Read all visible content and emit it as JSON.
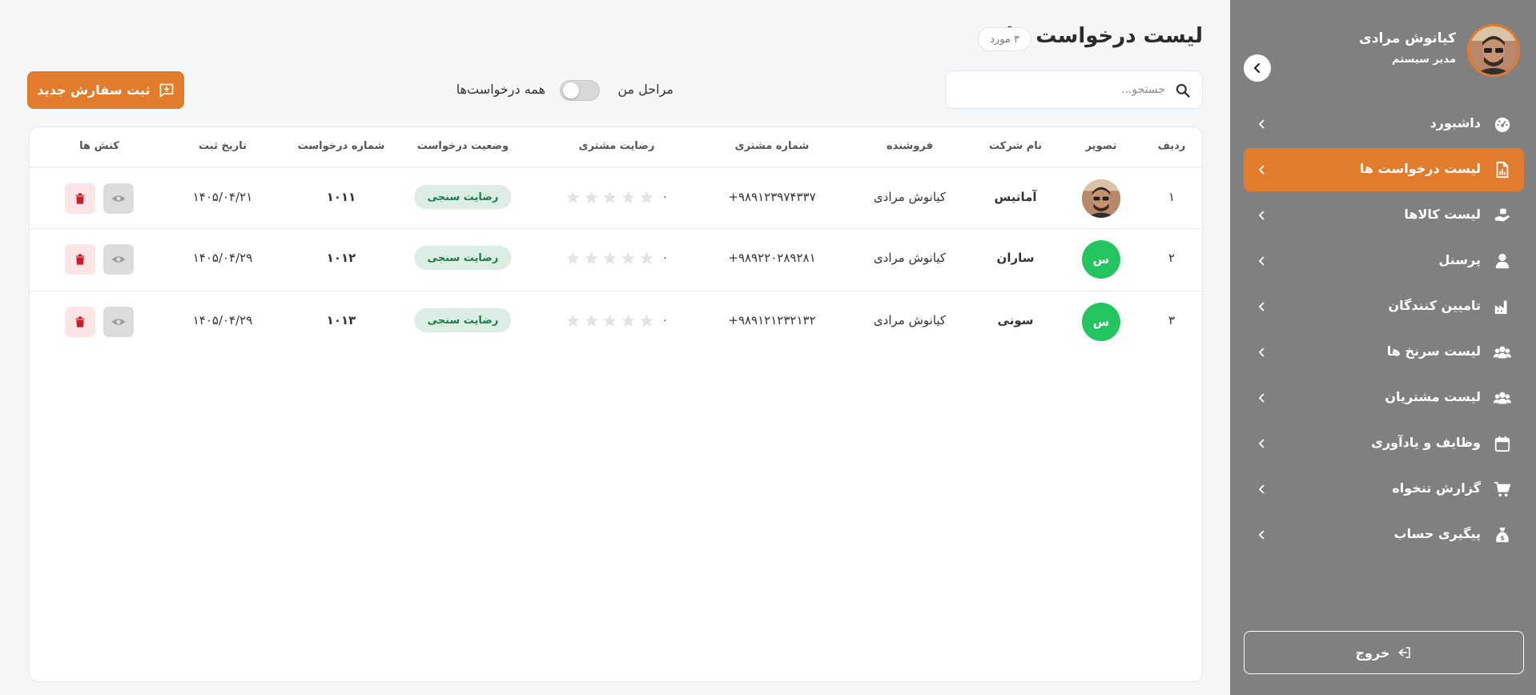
{
  "sidebar": {
    "profile_name": "کیانوش مرادی",
    "profile_role": "مدیر سیستم",
    "items": [
      {
        "label": "داشبورد",
        "icon": "gauge-icon",
        "active": false
      },
      {
        "label": "لیست درخواست ها",
        "icon": "document-chart-icon",
        "active": true
      },
      {
        "label": "لیست کالاها",
        "icon": "hand-box-icon",
        "active": false
      },
      {
        "label": "پرسنل",
        "icon": "user-icon",
        "active": false
      },
      {
        "label": "تامیین کنندگان",
        "icon": "factory-icon",
        "active": false
      },
      {
        "label": "لیست سرنخ ها",
        "icon": "users-icon",
        "active": false
      },
      {
        "label": "لیست مشتریان",
        "icon": "users-icon",
        "active": false
      },
      {
        "label": "وظایف و یادآوری",
        "icon": "calendar-icon",
        "active": false
      },
      {
        "label": "گزارش تنخواه",
        "icon": "cart-icon",
        "active": false
      },
      {
        "label": "پیگیری حساب",
        "icon": "money-bag-icon",
        "active": false
      }
    ],
    "logout_label": "خروج"
  },
  "header": {
    "title": "لیست درخواست ها",
    "count_badge": "۳ مورد"
  },
  "toolbar": {
    "search_placeholder": "جستجو...",
    "search_value": "",
    "my_steps_label": "مراحل من",
    "all_requests_label": "همه درخواست‌ها",
    "toggle_on": false,
    "new_order_label": "ثبت سفارش جدید"
  },
  "table": {
    "headers": {
      "row": "ردیف",
      "image": "تصویر",
      "company": "نام شرکت",
      "seller": "فروشنده",
      "phone": "شماره مشتری",
      "satisfaction": "رضایت مشتری",
      "status": "وضعیت درخواست",
      "request_no": "شماره درخواست",
      "date": "تاریخ ثبت",
      "actions": "کنش ها"
    },
    "rows": [
      {
        "row": "۱",
        "avatar": "photo",
        "company": "آماتیس",
        "seller": "کیانوش مرادی",
        "phone": "+۹۸۹۱۲۳۹۷۴۳۳۷",
        "rating": "۰",
        "status": "رضایت سنجی",
        "request_no": "۱۰۱۱",
        "date": "۱۴۰۵/۰۴/۲۱"
      },
      {
        "row": "۲",
        "avatar": "س",
        "company": "ساران",
        "seller": "کیانوش مرادی",
        "phone": "+۹۸۹۲۲۰۲۸۹۲۸۱",
        "rating": "۰",
        "status": "رضایت سنجی",
        "request_no": "۱۰۱۲",
        "date": "۱۴۰۵/۰۴/۲۹"
      },
      {
        "row": "۳",
        "avatar": "س",
        "company": "سونی",
        "seller": "کیانوش مرادی",
        "phone": "+۹۸۹۱۲۱۲۳۲۱۳۲",
        "rating": "۰",
        "status": "رضایت سنجی",
        "request_no": "۱۰۱۳",
        "date": "۱۴۰۵/۰۴/۲۹"
      }
    ]
  },
  "colors": {
    "accent": "#e37b2c",
    "sidebar_bg": "#808080",
    "status_bg": "#dceee4",
    "status_text": "#1d7a4a",
    "avatar_green": "#22c55e",
    "delete_red": "#c81e2c"
  }
}
